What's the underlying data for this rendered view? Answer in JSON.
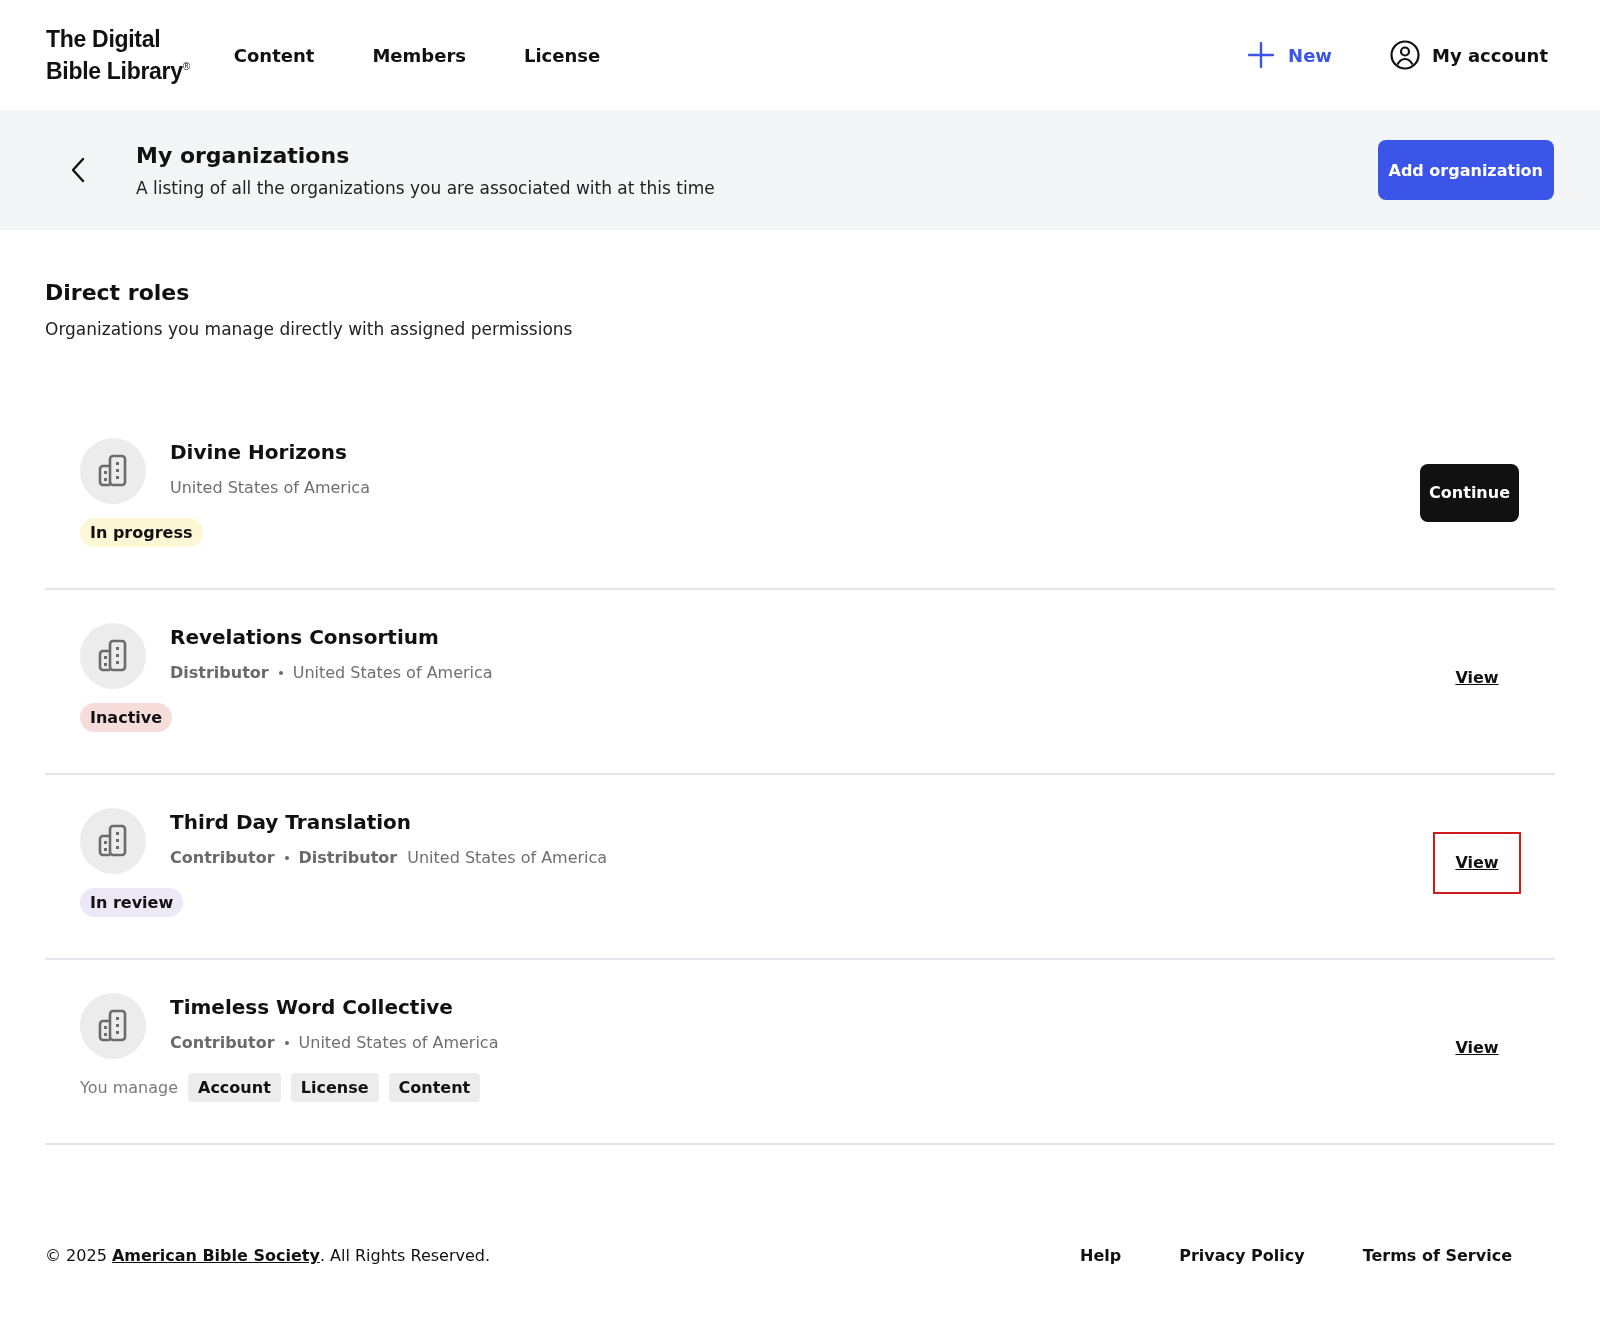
{
  "header": {
    "logo": {
      "line1": "The Digital",
      "line2": "Bible Library",
      "mark": "®"
    },
    "nav": [
      {
        "label": "Content"
      },
      {
        "label": "Members"
      },
      {
        "label": "License"
      }
    ],
    "new_button": {
      "label": "New"
    },
    "account": {
      "label": "My account"
    }
  },
  "page_header": {
    "title": "My organizations",
    "subtitle": "A listing of all the organizations you are associated with at this time",
    "action": "Add organization"
  },
  "section": {
    "title": "Direct roles",
    "subtitle": "Organizations you manage directly with assigned permissions"
  },
  "organizations": [
    {
      "name": "Divine Horizons",
      "meta": [
        {
          "kind": "country",
          "text": "United States of America"
        }
      ],
      "status": {
        "label": "In progress",
        "color": "#fdf7d6"
      },
      "action": {
        "kind": "button",
        "label": "Continue",
        "highlighted": false
      }
    },
    {
      "name": "Revelations Consortium",
      "meta": [
        {
          "kind": "role",
          "text": "Distributor"
        },
        {
          "kind": "separator"
        },
        {
          "kind": "country",
          "text": "United States of America"
        }
      ],
      "status": {
        "label": "Inactive",
        "color": "#f7dcdc"
      },
      "action": {
        "kind": "link",
        "label": "View",
        "highlighted": false
      }
    },
    {
      "name": "Third Day Translation",
      "meta": [
        {
          "kind": "role",
          "text": "Contributor"
        },
        {
          "kind": "separator"
        },
        {
          "kind": "role",
          "text": "Distributor"
        },
        {
          "kind": "country",
          "text": "United States of America"
        }
      ],
      "status": {
        "label": "In review",
        "color": "#ece8f6"
      },
      "action": {
        "kind": "link",
        "label": "View",
        "highlighted": true
      }
    },
    {
      "name": "Timeless Word Collective",
      "meta": [
        {
          "kind": "role",
          "text": "Contributor"
        },
        {
          "kind": "separator"
        },
        {
          "kind": "country",
          "text": "United States of America"
        }
      ],
      "manage": {
        "label": "You manage",
        "tags": [
          "Account",
          "License",
          "Content"
        ]
      },
      "action": {
        "kind": "link",
        "label": "View",
        "highlighted": false
      }
    }
  ],
  "footer": {
    "pre": "© 2025 ",
    "link": "American Bible Society",
    "post": ". All Rights Reserved.",
    "links": [
      "Help",
      "Privacy Policy",
      "Terms of Service"
    ]
  }
}
